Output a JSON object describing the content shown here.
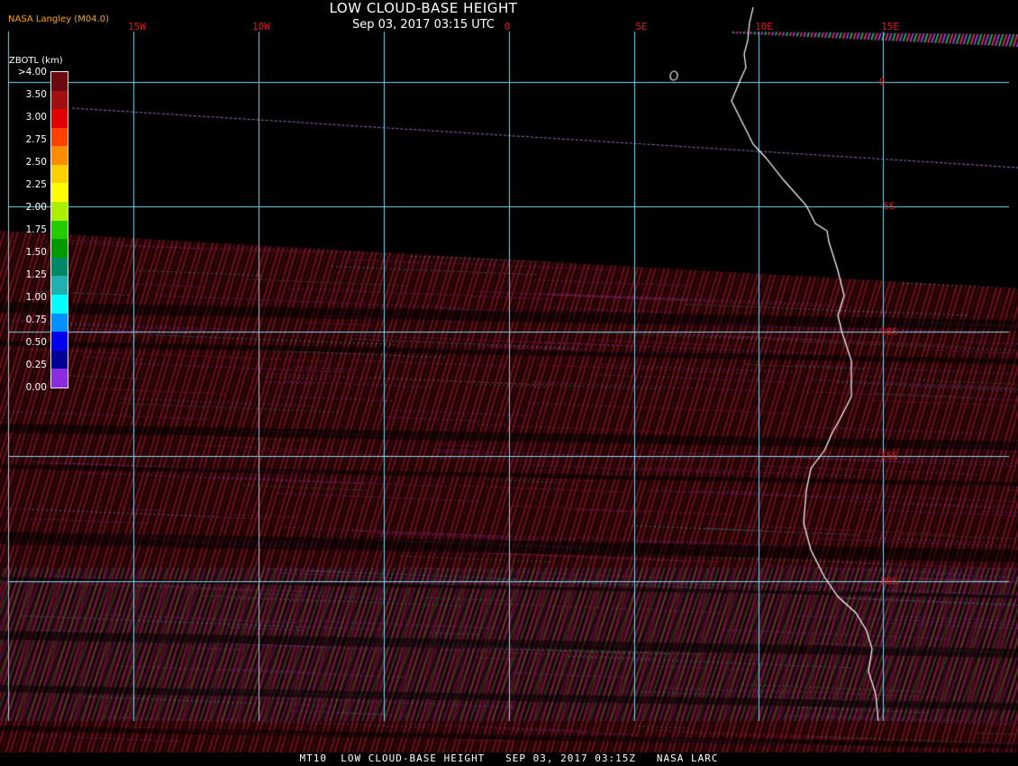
{
  "header": {
    "title": "LOW CLOUD-BASE HEIGHT",
    "subtitle": "Sep 03, 2017 03:15 UTC",
    "producer": "NASA Langley (M04.0)"
  },
  "legend": {
    "title": "ZBOTL (km)",
    "labels": [
      ">4.00",
      "3.50",
      "3.00",
      "2.75",
      "2.50",
      "2.25",
      "2.00",
      "1.75",
      "1.50",
      "1.25",
      "1.00",
      "0.75",
      "0.50",
      "0.25",
      "0.00"
    ],
    "colors": [
      "#6a0a10",
      "#a01010",
      "#e00000",
      "#ff4000",
      "#ff8c00",
      "#ffd000",
      "#ffff00",
      "#aaee00",
      "#22cc00",
      "#009900",
      "#008866",
      "#20b0b0",
      "#00ffff",
      "#0090ff",
      "#0000ee",
      "#000099",
      "#8a2be2"
    ]
  },
  "grid": {
    "longitude_labels": [
      "15W",
      "10W",
      "0",
      "5E",
      "10E",
      "15E"
    ],
    "latitude_labels": [
      "0",
      "5S",
      "10S",
      "15S",
      "20S"
    ],
    "line_color": "#7fd8ee"
  },
  "footer": {
    "text": "MT10  LOW CLOUD-BASE HEIGHT   SEP 03, 2017 03:15Z   NASA LARC"
  }
}
